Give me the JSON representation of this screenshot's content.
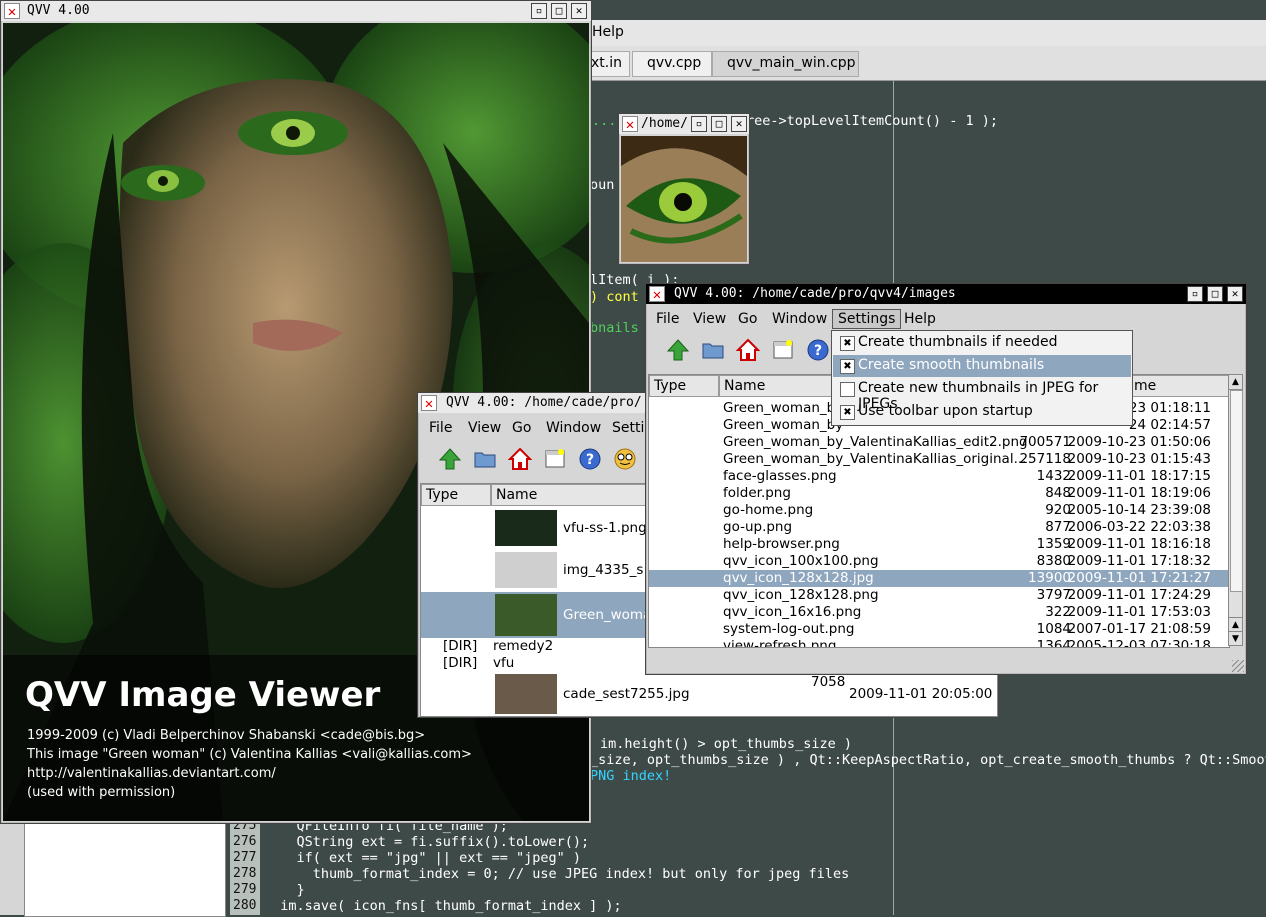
{
  "editor": {
    "menu_help": "Help",
    "tabs": [
      "xt.in",
      "qvv.cpp",
      "qvv_main_win.cpp"
    ],
    "code_top": [
      {
        "t": "...",
        "c": "#4fd05a"
      },
      {
        "t": "ree->topLevelItemCount() - 1 );",
        "c": "#ffffff"
      },
      {
        "t": "oun",
        "c": "#ffffff"
      },
      {
        "t": "lItem( i );",
        "c": "#ffffff"
      },
      {
        "t": ") cont",
        "c": "#ffff40"
      },
      {
        "t": "bnails",
        "c": "#4fd05a"
      }
    ],
    "code_mid": [
      {
        "t": "im.height() > opt_thumbs_size )",
        "c": "#ffffff"
      },
      {
        "t": "_size, opt_thumbs_size ) , Qt::KeepAspectRatio, opt_create_smooth_thumbs ? Qt::Smooth",
        "c": "#ffffff"
      },
      {
        "t": "PNG index!",
        "c": "#34d4ff"
      }
    ],
    "lines": [
      {
        "n": "275",
        "t": "    QFileInfo fi( file_name );"
      },
      {
        "n": "276",
        "t": "    QString ext = fi.suffix().toLower();"
      },
      {
        "n": "277",
        "t": "    if( ext == \"jpg\" || ext == \"jpeg\" )"
      },
      {
        "n": "278",
        "t": "      thumb_format_index = 0; // use JPEG index! but only for jpeg files"
      },
      {
        "n": "279",
        "t": "    }"
      },
      {
        "n": "280",
        "t": "  im.save( icon_fns[ thumb_format_index ] );"
      }
    ]
  },
  "splash": {
    "window_title": "QVV 4.00",
    "heading": "QVV Image Viewer",
    "lines": [
      "1999-2009 (c) Vladi Belperchinov Shabanski <cade@bis.bg>",
      "This image \"Green woman\" (c) Valentina Kallias <vali@kallias.com>",
      "http://valentinakallias.deviantart.com/",
      "(used with permission)"
    ]
  },
  "preview": {
    "window_title": "/home/"
  },
  "browser_small": {
    "window_title": "QVV 4.00: /home/cade/pro/",
    "menu": [
      "File",
      "View",
      "Go",
      "Window",
      "Settin"
    ],
    "columns": [
      "Type",
      "Name"
    ],
    "rows": [
      {
        "type": "",
        "name": "vfu-ss-1.png",
        "size": "",
        "date": ""
      },
      {
        "type": "",
        "name": "img_4335_s",
        "size": "",
        "date": ""
      },
      {
        "type": "",
        "name": "Green_woma",
        "size": "",
        "date": ""
      },
      {
        "type": "[DIR]",
        "name": "remedy2",
        "size": "",
        "date": ""
      },
      {
        "type": "[DIR]",
        "name": "vfu",
        "size": "",
        "date": ""
      },
      {
        "type": "",
        "name": "cade_sest7255.jpg",
        "size": "7058",
        "date": "2009-11-01 20:05:00"
      }
    ]
  },
  "browser_main": {
    "window_title": "QVV 4.00: /home/cade/pro/qvv4/images",
    "menu": [
      "File",
      "View",
      "Go",
      "Window",
      "Settings",
      "Help"
    ],
    "columns": [
      "Type",
      "Name",
      "me"
    ],
    "settings_menu": [
      {
        "label": "Create thumbnails if needed",
        "checked": true
      },
      {
        "label": "Create smooth thumbnails",
        "checked": true
      },
      {
        "label": "Create new thumbnails in JPEG for JPEGs",
        "checked": false
      },
      {
        "label": "Use toolbar upon startup",
        "checked": true
      }
    ],
    "rows": [
      {
        "name": "Green_woman_by",
        "size": "",
        "date": "-23 01:18:11"
      },
      {
        "name": "Green_woman_by",
        "size": "",
        "date": "-24 02:14:57"
      },
      {
        "name": "Green_woman_by_ValentinaKallias_edit2.png",
        "size": "700571",
        "date": "2009-10-23 01:50:06"
      },
      {
        "name": "Green_woman_by_ValentinaKallias_original...",
        "size": "257118",
        "date": "2009-10-23 01:15:43"
      },
      {
        "name": "face-glasses.png",
        "size": "1432",
        "date": "2009-11-01 18:17:15"
      },
      {
        "name": "folder.png",
        "size": "848",
        "date": "2009-11-01 18:19:06"
      },
      {
        "name": "go-home.png",
        "size": "920",
        "date": "2005-10-14 23:39:08"
      },
      {
        "name": "go-up.png",
        "size": "877",
        "date": "2006-03-22 22:03:38"
      },
      {
        "name": "help-browser.png",
        "size": "1359",
        "date": "2009-11-01 18:16:18"
      },
      {
        "name": "qvv_icon_100x100.png",
        "size": "8380",
        "date": "2009-11-01 17:18:32"
      },
      {
        "name": "qvv_icon_128x128.jpg",
        "size": "13900",
        "date": "2009-11-01 17:21:27",
        "selected": true
      },
      {
        "name": "qvv_icon_128x128.png",
        "size": "3797",
        "date": "2009-11-01 17:24:29"
      },
      {
        "name": "qvv_icon_16x16.png",
        "size": "322",
        "date": "2009-11-01 17:53:03"
      },
      {
        "name": "system-log-out.png",
        "size": "1084",
        "date": "2007-01-17 21:08:59"
      },
      {
        "name": "view-refresh.png",
        "size": "1364",
        "date": "2005-12-03 07:30:18"
      }
    ]
  }
}
